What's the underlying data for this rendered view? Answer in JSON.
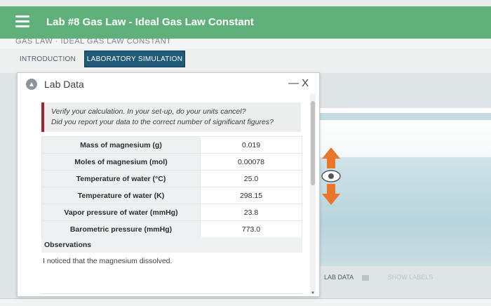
{
  "app": {
    "title": "Lab #8 Gas Law - Ideal Gas Law Constant",
    "subtitle": "GAS LAW · IDEAL GAS LAW CONSTANT"
  },
  "tabs": [
    {
      "label": "INTRODUCTION",
      "active": false
    },
    {
      "label": "LABORATORY SIMULATION",
      "active": true
    }
  ],
  "modal": {
    "title": "Lab Data",
    "close_label": "— X",
    "callout_line1": "Verify your calculation. In your set-up, do your units cancel?",
    "callout_line2": "Did you report your data to the correct number of significant figures?",
    "rows": [
      {
        "label": "Mass of magnesium (g)",
        "value": "0.019"
      },
      {
        "label": "Moles of magnesium (mol)",
        "value": "0.00078"
      },
      {
        "label": "Temperature of water (°C)",
        "value": "25.0"
      },
      {
        "label": "Temperature of water (K)",
        "value": "298.15"
      },
      {
        "label": "Vapor pressure of water (mmHg)",
        "value": "23.8"
      },
      {
        "label": "Barometric pressure (mmHg)",
        "value": "773.0"
      }
    ],
    "observations_label": "Observations",
    "observations_text": "I noticed that the magnesium dissolved."
  },
  "sim": {
    "lab_data_label": "LAB DATA",
    "show_labels": "SHOW LABELS"
  },
  "colors": {
    "topbar": "#5fb07a",
    "active_tab": "#1f5a78",
    "callout_accent": "#a2232a",
    "adjuster_arrow": "#e8762b"
  }
}
